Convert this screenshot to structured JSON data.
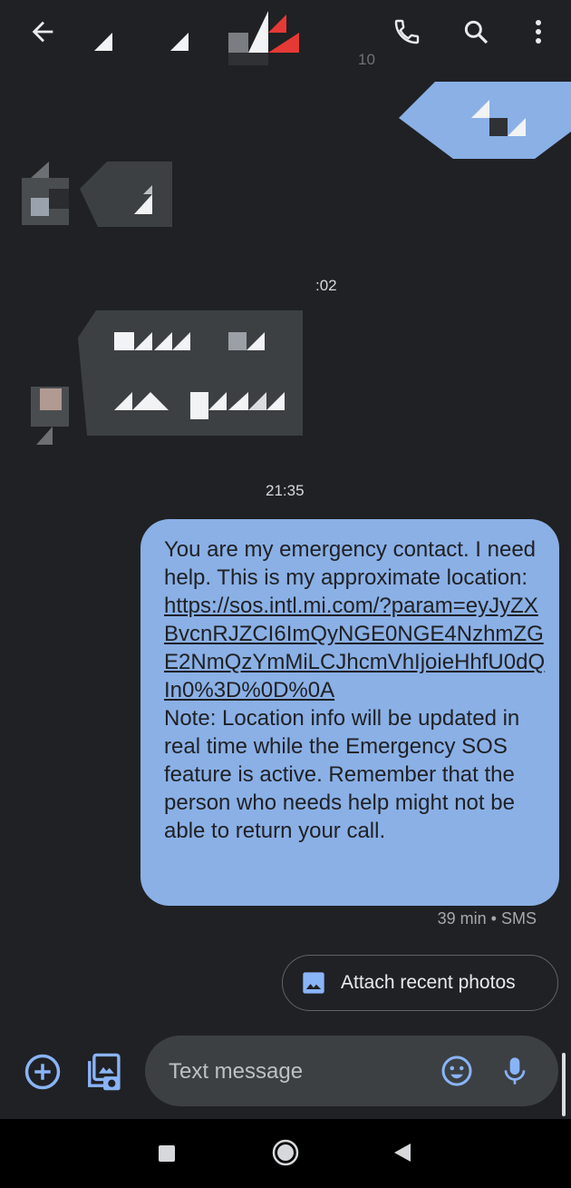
{
  "header": {
    "back_icon": "arrow-back-icon",
    "call_icon": "phone-icon",
    "search_icon": "search-icon",
    "menu_icon": "more-vert-icon"
  },
  "thread": {
    "timestamp_1_partial": "10",
    "timestamp_2_partial": ":02",
    "timestamp_3": "21:35",
    "message": {
      "line_intro": "You are my emergency contact. I need help. This is my approximate location:",
      "link": "https://sos.intl.mi.com/?param=eyJyZXBvcnRJZCI6ImQyNGE0NGE4NzhmZGE2NmQzYmMiLCJhcmVhIjoieHhfU0dQIn0%3D%0D%0A",
      "note": "Note: Location info will be updated in real time while the Emergency SOS feature is active. Remember that the person who needs help might not be able to return your call."
    },
    "meta": "39 min • SMS"
  },
  "suggestion": {
    "label": "Attach recent photos",
    "icon": "image-icon"
  },
  "composer": {
    "placeholder": "Text message",
    "add_icon": "add-circle-icon",
    "gallery_icon": "gallery-camera-icon",
    "emoji_icon": "emoji-icon",
    "mic_icon": "mic-icon"
  },
  "colors": {
    "background": "#202124",
    "bubble": "#8ab0e6",
    "accent": "#8ab4f8"
  }
}
